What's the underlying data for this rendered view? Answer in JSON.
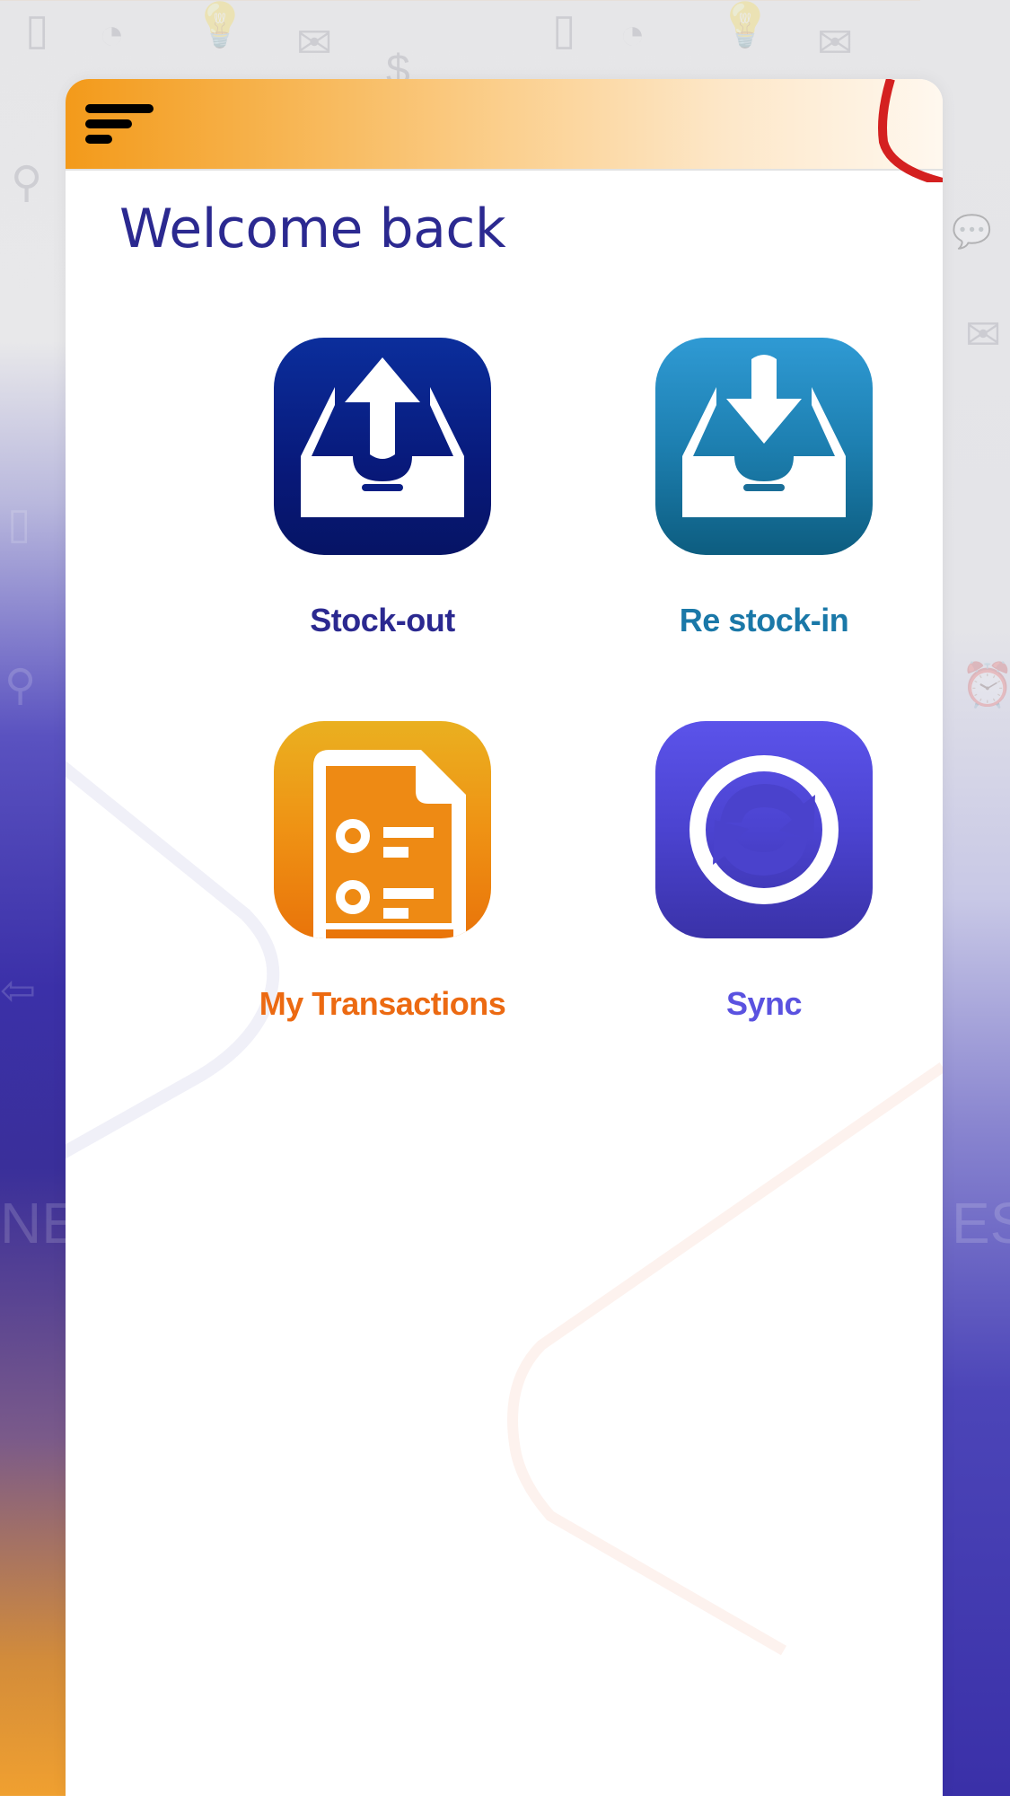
{
  "header": {
    "menu_icon": "menu-icon"
  },
  "main": {
    "title": "Welcome back",
    "tiles": [
      {
        "label": "Stock-out",
        "icon": "tray-upload-icon",
        "color": "#2b2990"
      },
      {
        "label": "Re stock-in",
        "icon": "tray-download-icon",
        "color": "#1a78a8"
      },
      {
        "label": "My Transactions",
        "icon": "document-list-icon",
        "color": "#ec6a12"
      },
      {
        "label": "Sync",
        "icon": "sync-icon",
        "color": "#5a52e0"
      }
    ]
  },
  "colors": {
    "accent_orange": "#f39a1a",
    "title_blue": "#2b2990",
    "header_curve_red": "#d42020"
  }
}
